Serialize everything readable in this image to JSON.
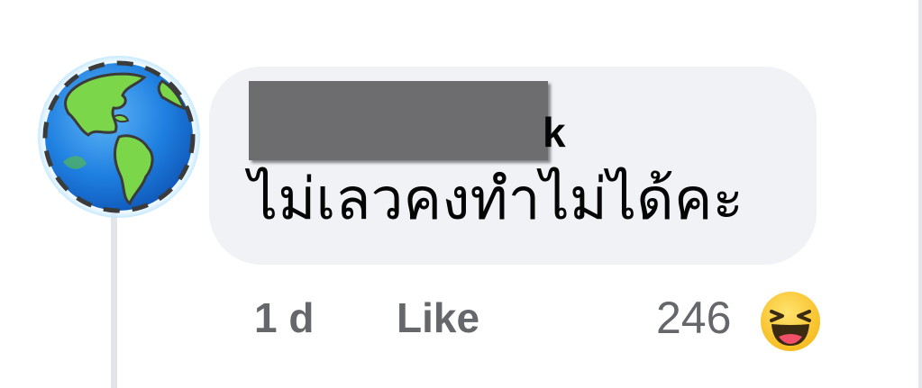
{
  "comment": {
    "author_name_tail": "k",
    "text": "ไม่เลวคงทำไม่ได้คะ",
    "timestamp": "1 d",
    "like_label": "Like",
    "reaction_count": "246",
    "reaction_type": "haha",
    "avatar_icon": "globe-earth-icon"
  },
  "colors": {
    "bubble_bg": "#f0f2f5",
    "meta_text": "#65676b",
    "body_text": "#050505",
    "redaction": "#6d6d6f"
  }
}
